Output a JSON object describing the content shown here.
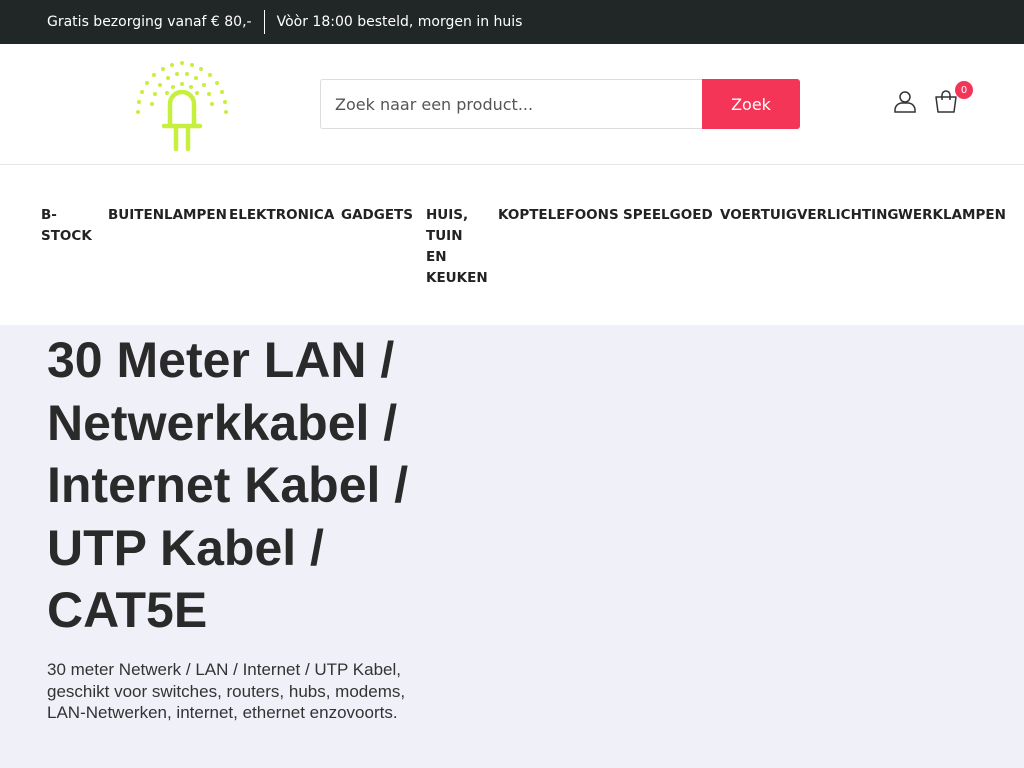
{
  "topbar": {
    "shipping_text": "Gratis bezorging vanaf € 80,-",
    "delivery_text": "Vòòr 18:00 besteld, morgen in huis"
  },
  "header": {
    "logo_icon": "led-bulb-logo",
    "search": {
      "placeholder": "Zoek naar een product...",
      "value": "",
      "button_label": "Zoek"
    },
    "account_icon": "user-icon",
    "cart": {
      "icon": "shopping-bag-icon",
      "count": "0"
    }
  },
  "nav": {
    "items": [
      {
        "label": "B-\nSTOCK"
      },
      {
        "label": "BUITENLAMPEN"
      },
      {
        "label": "ELEKTRONICA"
      },
      {
        "label": "GADGETS"
      },
      {
        "label": "HUIS,\nTUIN\nEN\nKEUKEN"
      },
      {
        "label": "KOPTELEFOONS"
      },
      {
        "label": "SPEELGOED"
      },
      {
        "label": "VOERTUIGVERLICHTING"
      },
      {
        "label": "WERKLAMPEN"
      }
    ]
  },
  "product": {
    "title": "30 Meter LAN / Netwerkkabel / Internet Kabel / UTP Kabel / CAT5E",
    "description": "30 meter Netwerk / LAN / Internet / UTP Kabel, geschikt voor switches, routers, hubs, modems, LAN-Netwerken, internet, ethernet enzovoorts."
  },
  "colors": {
    "topbar_bg": "#212627",
    "accent": "#f43557",
    "logo": "#c6ef3e",
    "hero_bg": "#f0f1f8"
  }
}
